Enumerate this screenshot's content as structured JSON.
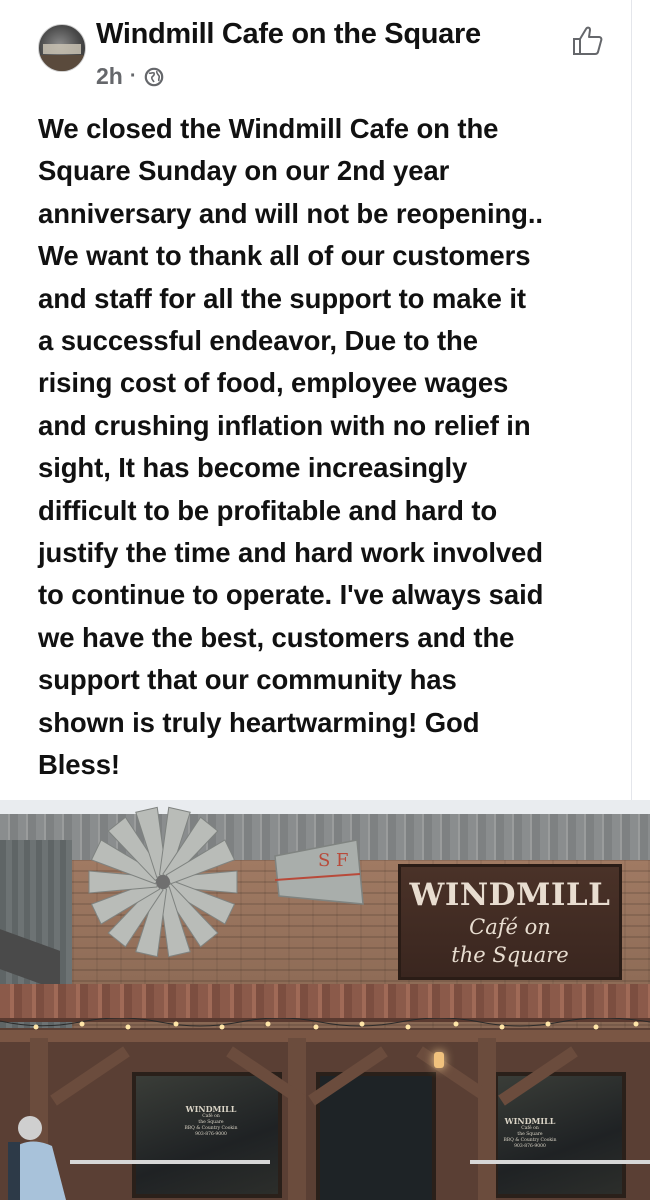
{
  "post": {
    "page_name": "Windmill Cafe on the Square",
    "timestamp": "2h",
    "separator": "·",
    "audience_icon": "globe-icon",
    "like_icon": "thumbs-up-icon",
    "text_lines": [
      "We closed the Windmill Cafe on the",
      "Square Sunday on our 2nd year",
      "anniversary and will not be reopening..",
      "We want to thank all of our customers",
      "and staff for all the support to make it",
      "a successful endeavor, Due to the",
      "rising cost of food, employee wages",
      "and crushing inflation with no relief in",
      "sight, It has become increasingly",
      "difficult to be profitable and hard to",
      "justify the time and hard work involved",
      "to continue to operate. I've always said",
      "we have the best, customers and the",
      "support that our community has",
      "shown is truly heartwarming! God",
      "Bless!"
    ]
  },
  "photo": {
    "sign_line1": "WINDMILL",
    "sign_line2": "Café on",
    "sign_line3": "the Square",
    "windmill_letters": "S F",
    "window_left": {
      "name": "WINDMILL",
      "sub1": "Café on",
      "sub2": "the Square",
      "sub3": "BBQ & Country Cookin",
      "phone": "903-876-9000"
    },
    "window_right": {
      "name": "WINDMILL",
      "sub1": "Café on",
      "sub2": "the Square",
      "sub3": "BBQ & Country Cookin",
      "phone": "903-876-9000"
    }
  },
  "colors": {
    "text": "#111111",
    "meta": "#65676b",
    "sign_bg": "#3a261f",
    "sign_text": "#e8ddd0"
  }
}
